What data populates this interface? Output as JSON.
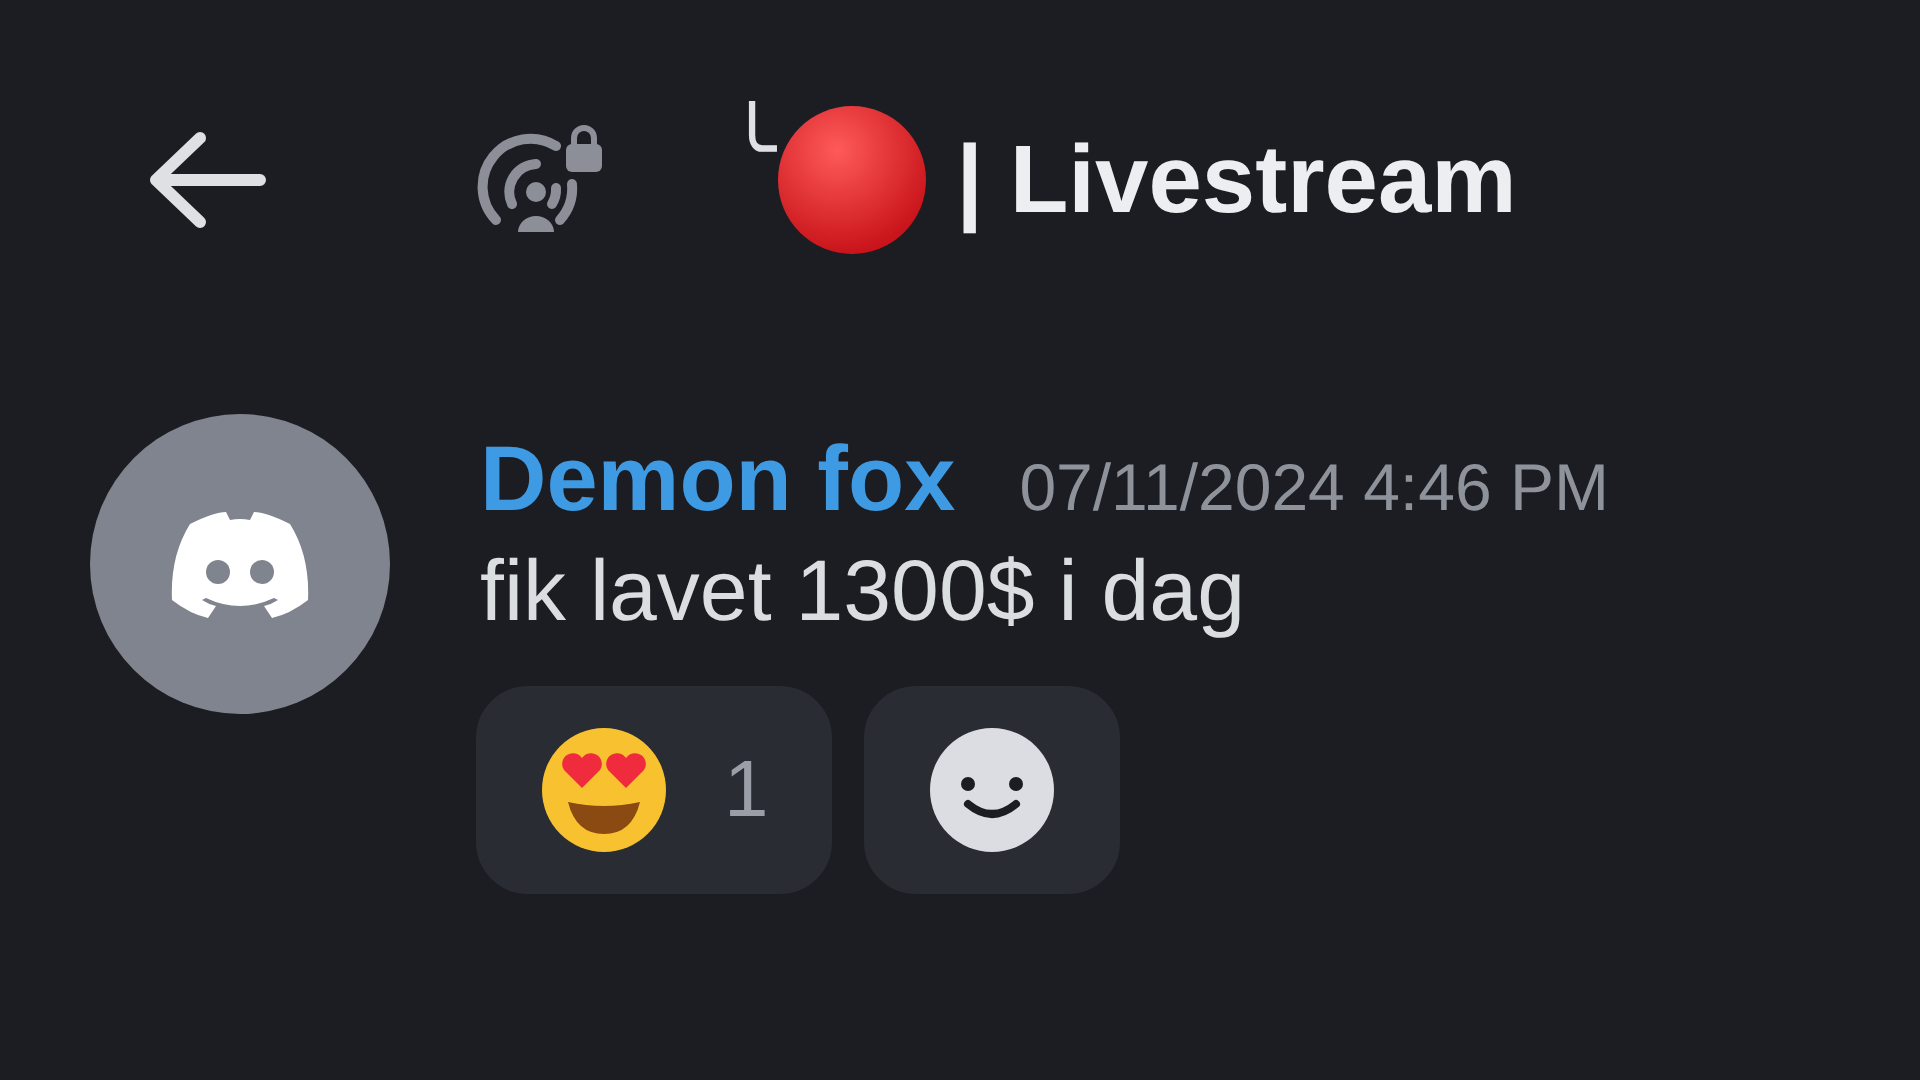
{
  "header": {
    "channel_prefix": "╰",
    "channel_name": "| Livestream"
  },
  "message": {
    "author": "Demon fox",
    "timestamp": "07/11/2024 4:46 PM",
    "text": "fik lavet 1300$ i dag",
    "reactions": [
      {
        "kind": "emoji",
        "count": "1",
        "selected": false
      },
      {
        "kind": "add"
      }
    ]
  }
}
